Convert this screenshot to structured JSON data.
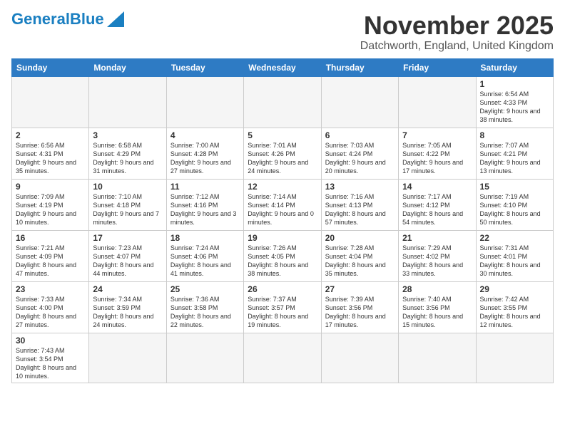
{
  "header": {
    "logo_general": "General",
    "logo_blue": "Blue",
    "month_title": "November 2025",
    "location": "Datchworth, England, United Kingdom"
  },
  "weekdays": [
    "Sunday",
    "Monday",
    "Tuesday",
    "Wednesday",
    "Thursday",
    "Friday",
    "Saturday"
  ],
  "days": [
    {
      "date": "",
      "info": ""
    },
    {
      "date": "",
      "info": ""
    },
    {
      "date": "",
      "info": ""
    },
    {
      "date": "",
      "info": ""
    },
    {
      "date": "",
      "info": ""
    },
    {
      "date": "",
      "info": ""
    },
    {
      "date": "1",
      "info": "Sunrise: 6:54 AM\nSunset: 4:33 PM\nDaylight: 9 hours\nand 38 minutes."
    },
    {
      "date": "2",
      "info": "Sunrise: 6:56 AM\nSunset: 4:31 PM\nDaylight: 9 hours\nand 35 minutes."
    },
    {
      "date": "3",
      "info": "Sunrise: 6:58 AM\nSunset: 4:29 PM\nDaylight: 9 hours\nand 31 minutes."
    },
    {
      "date": "4",
      "info": "Sunrise: 7:00 AM\nSunset: 4:28 PM\nDaylight: 9 hours\nand 27 minutes."
    },
    {
      "date": "5",
      "info": "Sunrise: 7:01 AM\nSunset: 4:26 PM\nDaylight: 9 hours\nand 24 minutes."
    },
    {
      "date": "6",
      "info": "Sunrise: 7:03 AM\nSunset: 4:24 PM\nDaylight: 9 hours\nand 20 minutes."
    },
    {
      "date": "7",
      "info": "Sunrise: 7:05 AM\nSunset: 4:22 PM\nDaylight: 9 hours\nand 17 minutes."
    },
    {
      "date": "8",
      "info": "Sunrise: 7:07 AM\nSunset: 4:21 PM\nDaylight: 9 hours\nand 13 minutes."
    },
    {
      "date": "9",
      "info": "Sunrise: 7:09 AM\nSunset: 4:19 PM\nDaylight: 9 hours\nand 10 minutes."
    },
    {
      "date": "10",
      "info": "Sunrise: 7:10 AM\nSunset: 4:18 PM\nDaylight: 9 hours\nand 7 minutes."
    },
    {
      "date": "11",
      "info": "Sunrise: 7:12 AM\nSunset: 4:16 PM\nDaylight: 9 hours\nand 3 minutes."
    },
    {
      "date": "12",
      "info": "Sunrise: 7:14 AM\nSunset: 4:14 PM\nDaylight: 9 hours\nand 0 minutes."
    },
    {
      "date": "13",
      "info": "Sunrise: 7:16 AM\nSunset: 4:13 PM\nDaylight: 8 hours\nand 57 minutes."
    },
    {
      "date": "14",
      "info": "Sunrise: 7:17 AM\nSunset: 4:12 PM\nDaylight: 8 hours\nand 54 minutes."
    },
    {
      "date": "15",
      "info": "Sunrise: 7:19 AM\nSunset: 4:10 PM\nDaylight: 8 hours\nand 50 minutes."
    },
    {
      "date": "16",
      "info": "Sunrise: 7:21 AM\nSunset: 4:09 PM\nDaylight: 8 hours\nand 47 minutes."
    },
    {
      "date": "17",
      "info": "Sunrise: 7:23 AM\nSunset: 4:07 PM\nDaylight: 8 hours\nand 44 minutes."
    },
    {
      "date": "18",
      "info": "Sunrise: 7:24 AM\nSunset: 4:06 PM\nDaylight: 8 hours\nand 41 minutes."
    },
    {
      "date": "19",
      "info": "Sunrise: 7:26 AM\nSunset: 4:05 PM\nDaylight: 8 hours\nand 38 minutes."
    },
    {
      "date": "20",
      "info": "Sunrise: 7:28 AM\nSunset: 4:04 PM\nDaylight: 8 hours\nand 35 minutes."
    },
    {
      "date": "21",
      "info": "Sunrise: 7:29 AM\nSunset: 4:02 PM\nDaylight: 8 hours\nand 33 minutes."
    },
    {
      "date": "22",
      "info": "Sunrise: 7:31 AM\nSunset: 4:01 PM\nDaylight: 8 hours\nand 30 minutes."
    },
    {
      "date": "23",
      "info": "Sunrise: 7:33 AM\nSunset: 4:00 PM\nDaylight: 8 hours\nand 27 minutes."
    },
    {
      "date": "24",
      "info": "Sunrise: 7:34 AM\nSunset: 3:59 PM\nDaylight: 8 hours\nand 24 minutes."
    },
    {
      "date": "25",
      "info": "Sunrise: 7:36 AM\nSunset: 3:58 PM\nDaylight: 8 hours\nand 22 minutes."
    },
    {
      "date": "26",
      "info": "Sunrise: 7:37 AM\nSunset: 3:57 PM\nDaylight: 8 hours\nand 19 minutes."
    },
    {
      "date": "27",
      "info": "Sunrise: 7:39 AM\nSunset: 3:56 PM\nDaylight: 8 hours\nand 17 minutes."
    },
    {
      "date": "28",
      "info": "Sunrise: 7:40 AM\nSunset: 3:56 PM\nDaylight: 8 hours\nand 15 minutes."
    },
    {
      "date": "29",
      "info": "Sunrise: 7:42 AM\nSunset: 3:55 PM\nDaylight: 8 hours\nand 12 minutes."
    },
    {
      "date": "30",
      "info": "Sunrise: 7:43 AM\nSunset: 3:54 PM\nDaylight: 8 hours\nand 10 minutes."
    },
    {
      "date": "",
      "info": ""
    },
    {
      "date": "",
      "info": ""
    },
    {
      "date": "",
      "info": ""
    },
    {
      "date": "",
      "info": ""
    },
    {
      "date": "",
      "info": ""
    },
    {
      "date": "",
      "info": ""
    }
  ]
}
